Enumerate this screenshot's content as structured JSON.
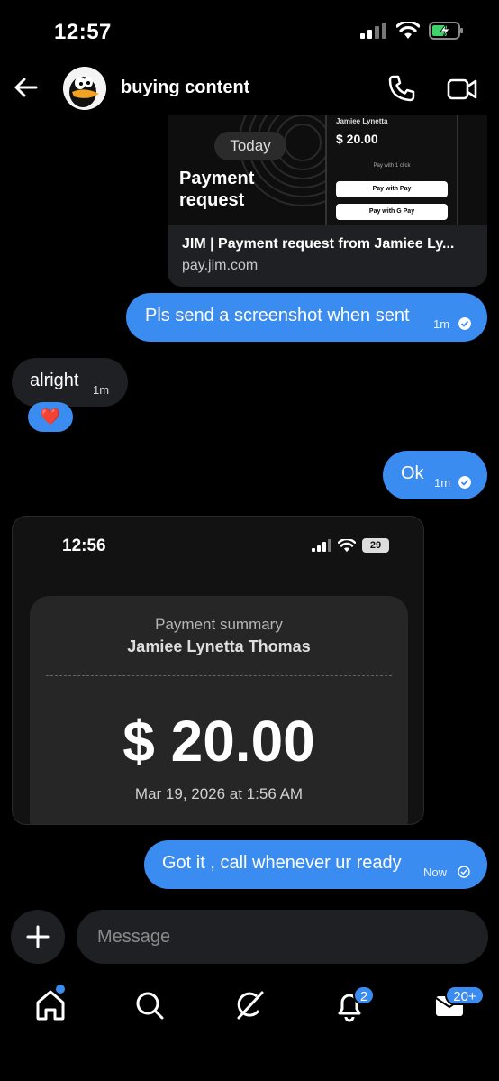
{
  "status_bar": {
    "time": "12:57"
  },
  "header": {
    "title": "buying content"
  },
  "link_preview": {
    "date_pill": "Today",
    "image_title": "Payment request",
    "image_payee": "Jamiee Lynetta",
    "image_amount": "$ 20.00",
    "image_pay_with": "Pay with 1 click",
    "image_apple_pay": "Pay with  Pay",
    "image_google_pay": "Pay with G Pay",
    "title": "JIM | Payment request from Jamiee Ly...",
    "url": "pay.jim.com"
  },
  "messages": [
    {
      "text": "Pls send a screenshot when sent",
      "time": "1m",
      "direction": "out"
    },
    {
      "text": "alright",
      "time": "1m",
      "direction": "in",
      "reaction": "❤️"
    },
    {
      "text": "Ok",
      "time": "1m",
      "direction": "out"
    },
    {
      "text": "Got it , call whenever ur ready",
      "time": "Now",
      "direction": "out"
    }
  ],
  "screenshot": {
    "time": "12:56",
    "battery": "29",
    "label": "Payment summary",
    "name": "Jamiee Lynetta Thomas",
    "amount": "$ 20.00",
    "date": "Mar 19, 2026 at 1:56 AM"
  },
  "composer": {
    "placeholder": "Message"
  },
  "bottom_nav": {
    "notifications_badge": "2",
    "messages_badge": "20+"
  },
  "colors": {
    "accent": "#3b8cf0",
    "background": "#000000",
    "bubble_in": "#1f2023"
  }
}
